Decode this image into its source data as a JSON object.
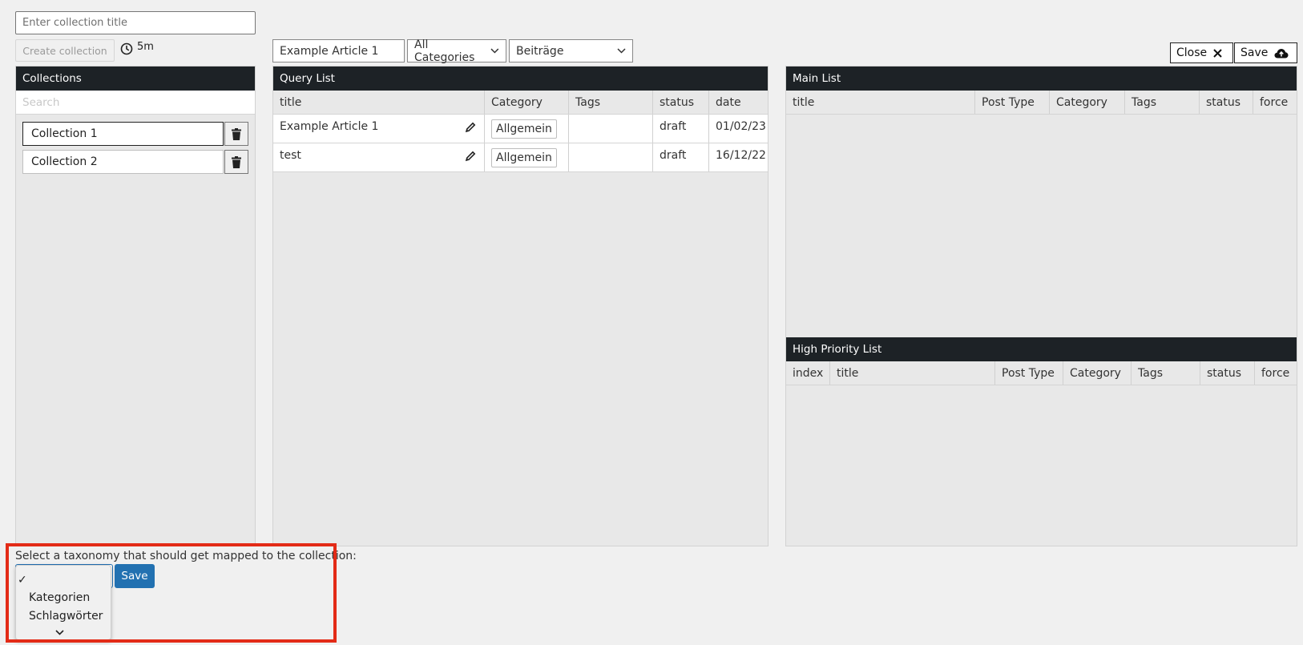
{
  "collection_title": {
    "placeholder": "Enter collection title"
  },
  "create_button": "Create collection",
  "timer": "5m",
  "collections": {
    "header": "Collections",
    "search_placeholder": "Search",
    "items": [
      {
        "label": "Collection 1"
      },
      {
        "label": "Collection 2"
      }
    ]
  },
  "query": {
    "search_value": "Example Article 1",
    "category_filter": "All Categories",
    "post_type_filter": "Beiträge",
    "header": "Query List",
    "columns": [
      "title",
      "Category",
      "Tags",
      "status",
      "date"
    ],
    "rows": [
      {
        "title": "Example Article 1",
        "category": "Allgemein",
        "tags": "",
        "status": "draft",
        "date": "01/02/23"
      },
      {
        "title": "test",
        "category": "Allgemein",
        "tags": "",
        "status": "draft",
        "date": "16/12/22"
      }
    ]
  },
  "actions": {
    "close": "Close",
    "save": "Save"
  },
  "main_list": {
    "header": "Main List",
    "columns": [
      "title",
      "Post Type",
      "Category",
      "Tags",
      "status",
      "force"
    ]
  },
  "high_priority_list": {
    "header": "High Priority List",
    "columns": [
      "index",
      "title",
      "Post Type",
      "Category",
      "Tags",
      "status",
      "force"
    ]
  },
  "taxonomy": {
    "label": "Select a taxonomy that should get mapped to the collection:",
    "save": "Save",
    "checkmark": "✓",
    "options": [
      "Kategorien",
      "Schlagwörter"
    ]
  }
}
